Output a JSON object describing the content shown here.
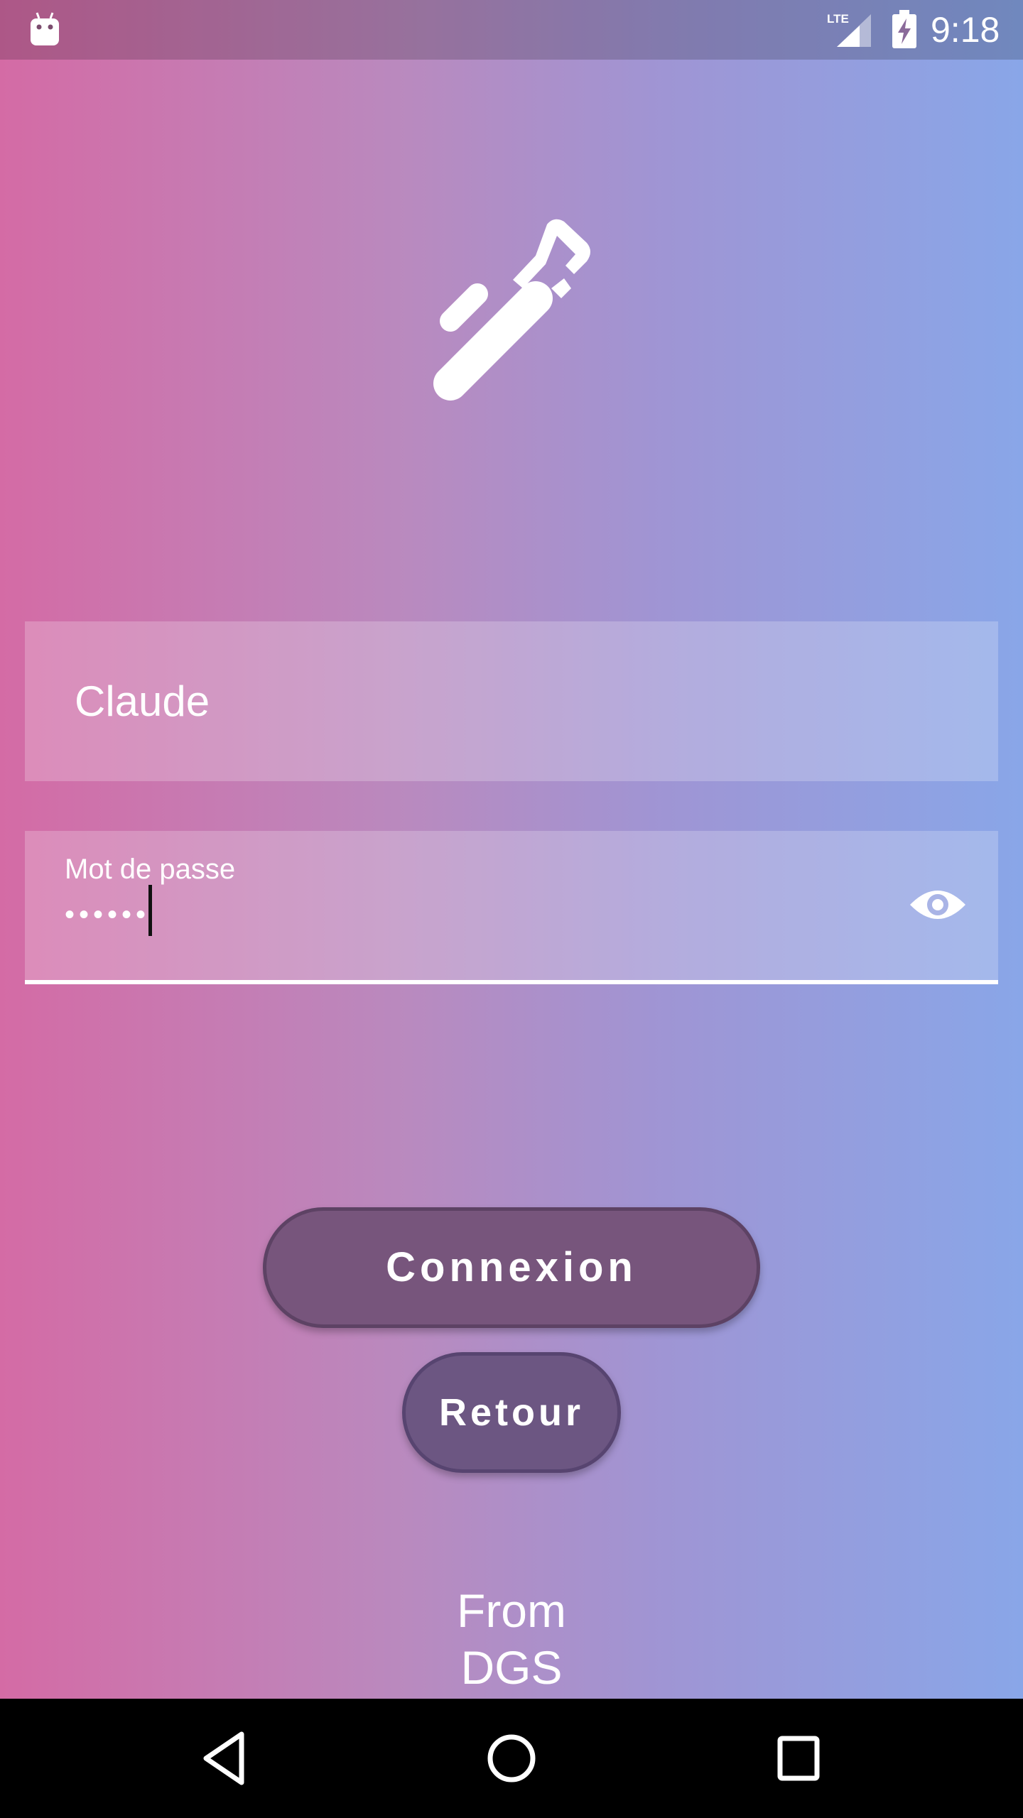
{
  "status_bar": {
    "time": "9:18",
    "network_label": "LTE",
    "icons": [
      "android-icon",
      "lte-signal-icon",
      "battery-charging-icon"
    ]
  },
  "logo": {
    "icon": "pipe-wrench-icon"
  },
  "login_form": {
    "username": {
      "value": "Claude"
    },
    "password": {
      "label": "Mot de passe",
      "masked_value": "••••••",
      "visibility_icon": "eye-icon"
    }
  },
  "actions": {
    "connexion_label": "Connexion",
    "retour_label": "Retour"
  },
  "footer": {
    "line1": "From",
    "line2": "DGS"
  },
  "nav_bar": {
    "icons": [
      "back-icon",
      "home-icon",
      "recent-apps-icon"
    ]
  },
  "colors": {
    "gradient_left": "#d46ba5",
    "gradient_right": "#89a6e8",
    "button_fill": "#77557c"
  }
}
